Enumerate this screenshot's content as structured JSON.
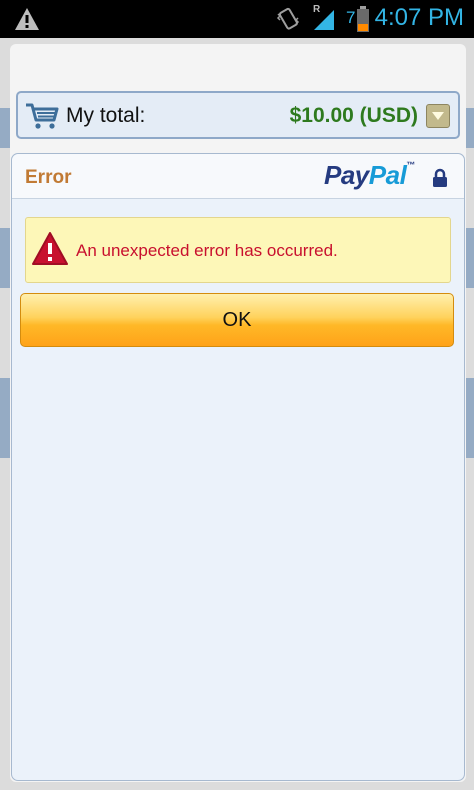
{
  "status_bar": {
    "time": "4:07 PM",
    "roaming_indicator": "R",
    "battery_level": "7",
    "icons": [
      "warning-icon",
      "vibrate-icon",
      "signal-icon",
      "battery-icon"
    ]
  },
  "order": {
    "label": "My total:",
    "amount": "$10.00 (USD)",
    "icons": [
      "cart-icon",
      "dropdown-icon"
    ]
  },
  "dialog": {
    "title": "Error",
    "brand": {
      "part1": "Pay",
      "part2": "Pal",
      "tm": "™"
    },
    "message": "An unexpected error has occurred.",
    "ok_label": "OK"
  },
  "colors": {
    "title": "#c17a34",
    "error_text": "#c8102e",
    "amount": "#2e7a1e",
    "button_orange": "#ffb827",
    "paypal_dark": "#253b80",
    "paypal_light": "#179bd7"
  }
}
